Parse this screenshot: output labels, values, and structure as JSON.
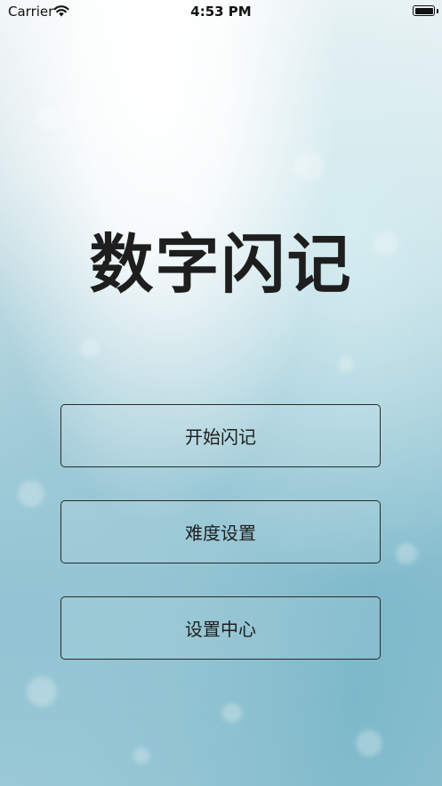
{
  "status_bar": {
    "carrier": "Carrier",
    "time": "4:53 PM",
    "battery_level_percent": 100
  },
  "title": "数字闪记",
  "menu": [
    {
      "label": "开始闪记"
    },
    {
      "label": "难度设置"
    },
    {
      "label": "设置中心"
    }
  ],
  "colors": {
    "text": "#1e1e1e",
    "button_border": "#2a2a2a",
    "background_top": "#eef4f5",
    "background_bottom": "#8fc2d2"
  },
  "icons": [
    "wifi-icon",
    "battery-icon"
  ]
}
